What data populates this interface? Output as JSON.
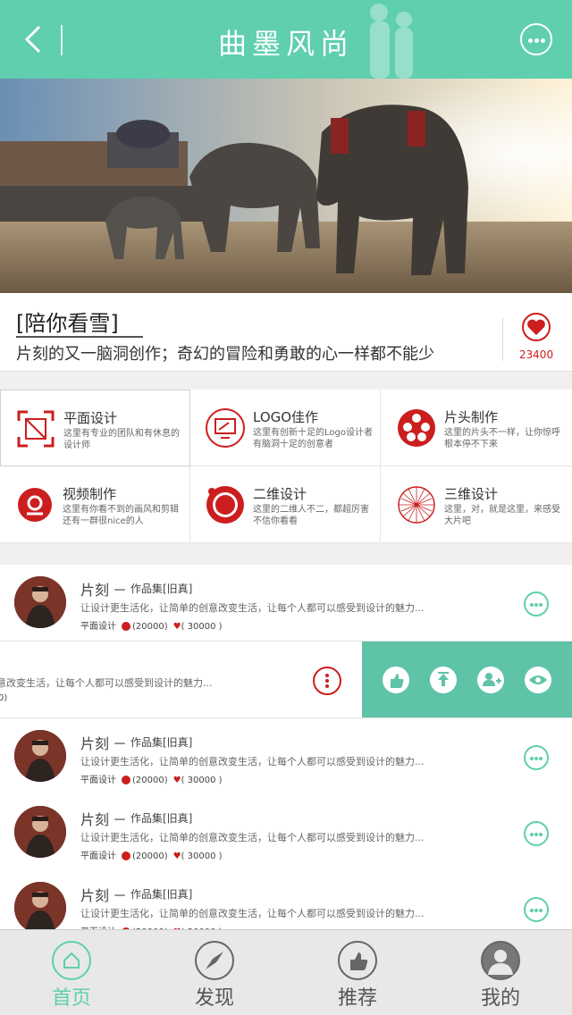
{
  "header": {
    "title": "曲墨风尚"
  },
  "feature": {
    "title": "[陪你看雪]",
    "subtitle": "片刻的又一脑洞创作；奇幻的冒险和勇敢的心一样都不能少",
    "like_count": "23400"
  },
  "categories": [
    {
      "name": "平面设计",
      "desc": "这里有专业的团队和有休息的设计师",
      "icon": "frame-icon"
    },
    {
      "name": "LOGO佳作",
      "desc": "这里有创新十足的Logo设计者有脑洞十足的创意者",
      "icon": "monitor-icon"
    },
    {
      "name": "片头制作",
      "desc": "这里的片头不一样，让你惊呼根本停不下来",
      "icon": "film-reel-icon"
    },
    {
      "name": "视频制作",
      "desc": "这里有你看不到的画风和剪辑还有一群很nice的人",
      "icon": "camera-icon"
    },
    {
      "name": "二维设计",
      "desc": "这里的二维人不二，都超厉害不信你看看",
      "icon": "target-icon"
    },
    {
      "name": "三维设计",
      "desc": "这里，对，就是这里，来感受大片吧",
      "icon": "sphere-icon"
    }
  ],
  "list": {
    "item": {
      "name": "片刻",
      "dash": "－",
      "tag": "作品集[旧真]",
      "desc": "让设计更生活化，让简单的创意改变生活，让每个人都可以感受到设计的魅力...",
      "category": "平面设计",
      "views": "(20000)",
      "likes": "( 30000 )"
    },
    "swiped": {
      "desc": "意改变生活，让每个人都可以感受到设计的魅力...",
      "meta": "0)"
    }
  },
  "tabs": [
    {
      "label": "首页",
      "icon": "home-icon",
      "active": true
    },
    {
      "label": "发现",
      "icon": "compass-icon",
      "active": false
    },
    {
      "label": "推荐",
      "icon": "thumbs-up-icon",
      "active": false
    },
    {
      "label": "我的",
      "icon": "user-icon",
      "active": false
    }
  ],
  "colors": {
    "accent": "#5fcfae",
    "red": "#cc1e1e"
  }
}
